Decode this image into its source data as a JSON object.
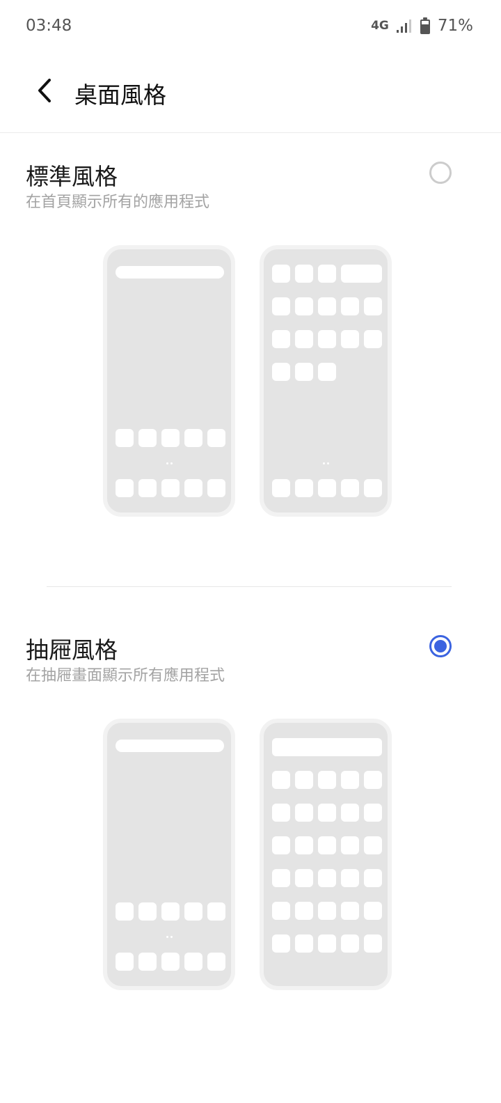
{
  "status_bar": {
    "time": "03:48",
    "network": "4G",
    "battery_percent": "71%",
    "icons": [
      "signal-icon",
      "battery-icon"
    ]
  },
  "header": {
    "title": "桌面風格",
    "back_icon": "chevron-left-icon"
  },
  "options": [
    {
      "title": "標準風格",
      "subtitle": "在首頁顯示所有的應用程式",
      "selected": false
    },
    {
      "title": "抽屜風格",
      "subtitle": "在抽屜畫面顯示所有應用程式",
      "selected": true
    }
  ],
  "colors": {
    "accent": "#3b63e0",
    "radio_unselected": "#cccccc",
    "preview_screen": "#e4e4e4",
    "preview_frame": "#f2f2f2"
  }
}
